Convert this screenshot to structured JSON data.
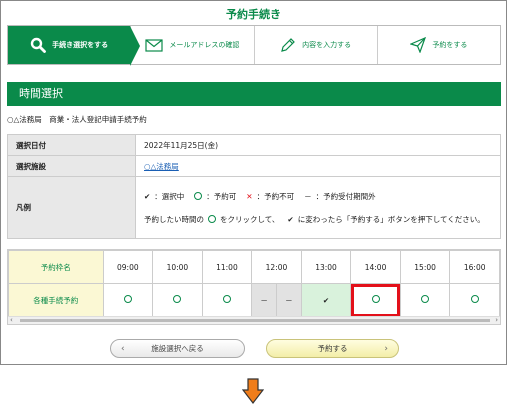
{
  "page_title": "予約手続き",
  "steps": [
    {
      "label": "手続き選択をする",
      "icon": "search-icon",
      "active": true
    },
    {
      "label": "メールアドレスの確認",
      "icon": "envelope-icon",
      "active": false
    },
    {
      "label": "内容を入力する",
      "icon": "pencil-icon",
      "active": false
    },
    {
      "label": "予約をする",
      "icon": "paper-plane-icon",
      "active": false
    }
  ],
  "section_title": "時間選択",
  "office_line": "○△法務局　商業・法人登記申請手続予約",
  "info": {
    "date_label": "選択日付",
    "date_value": "2022年11月25日(金)",
    "facility_label": "選択施設",
    "facility_value": "○△法務局",
    "legend_label": "凡例",
    "legend_selected": "：選択中",
    "legend_available": "：予約可",
    "legend_unavailable": "：予約不可",
    "legend_outside_mark": "－",
    "legend_outside": "：予約受付期間外",
    "instruction_a": "予約したい時間の",
    "instruction_b": "をクリックして、",
    "instruction_c": "に変わったら「予約する」ボタンを押下してください。"
  },
  "grid": {
    "header_label": "予約枠名",
    "row_label": "各種手続予約",
    "times": [
      "09:00",
      "10:00",
      "11:00",
      "12:00",
      "13:00",
      "14:00",
      "15:00",
      "16:00"
    ]
  },
  "buttons": {
    "back": "施設選択へ戻る",
    "reserve": "予約する"
  },
  "colors": {
    "accent": "#0a8a4a",
    "highlight": "#e3101a",
    "arrow": "#f07d1a"
  }
}
